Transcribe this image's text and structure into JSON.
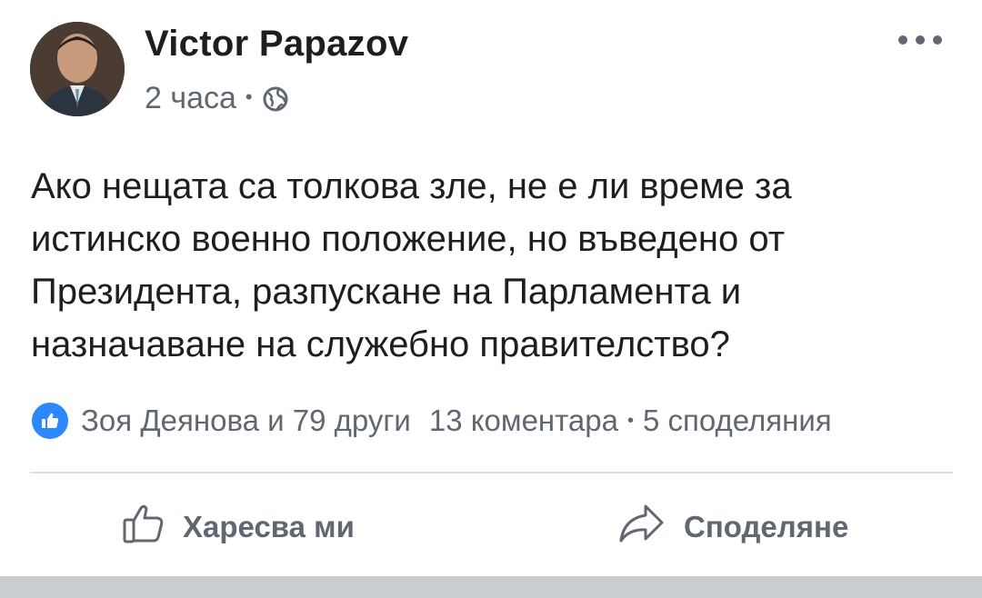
{
  "post": {
    "author_name": "Victor Papazov",
    "timestamp": "2 часа",
    "separator": "•",
    "privacy_icon": "globe-icon",
    "menu_icon": "more-options-icon",
    "text": "Ако нещата са толкова зле, не е ли време за истинско военно положение, но въведено от Президента, разпускане на Парламента и назначаване на служебно правителство?"
  },
  "reactions": {
    "icon": "like-icon",
    "reactors": "Зоя Деянова и 79 други",
    "comments": "13 коментара",
    "separator": "•",
    "shares": "5 споделяния"
  },
  "actions": {
    "like_label": "Харесва ми",
    "share_label": "Споделяне"
  },
  "colors": {
    "text_primary": "#1c1e21",
    "text_secondary": "#606770",
    "like_blue": "#2d88ff",
    "divider": "#dadde1"
  }
}
